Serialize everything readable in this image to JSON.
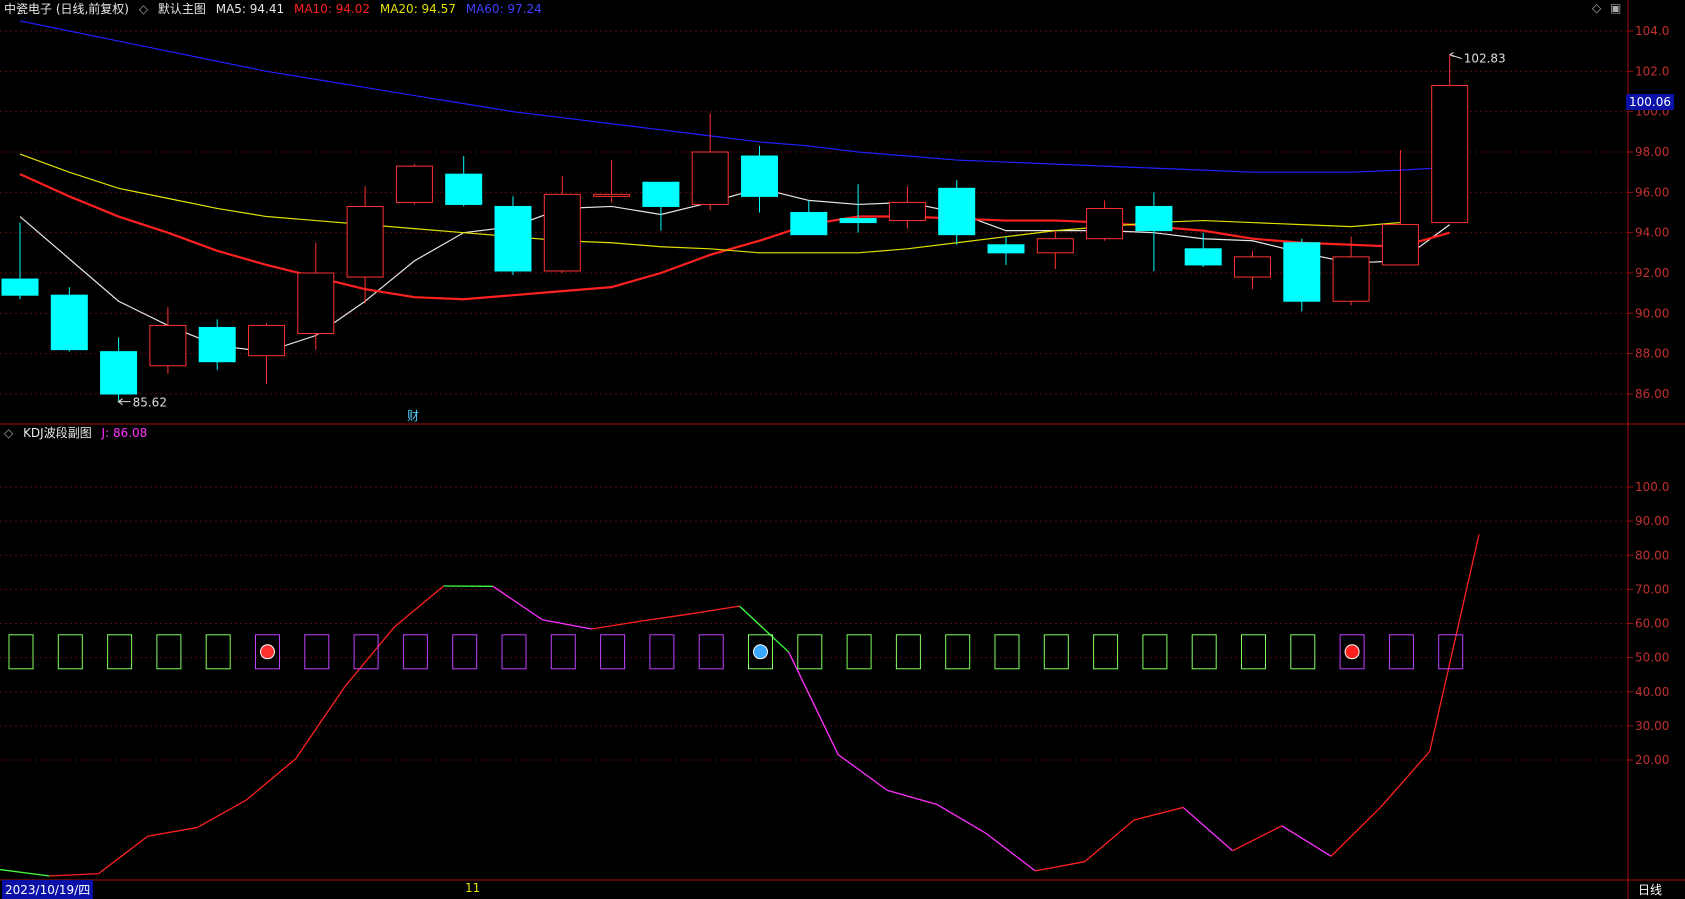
{
  "header": {
    "stock": "中瓷电子 (日线,前复权)",
    "panel_label": "默认主图",
    "ma5": {
      "label": "MA5: 94.41",
      "color": "#e6e6e6"
    },
    "ma10": {
      "label": "MA10: 94.02",
      "color": "#ff2020"
    },
    "ma20": {
      "label": "MA20: 94.57",
      "color": "#e0e000"
    },
    "ma60": {
      "label": "MA60: 97.24",
      "color": "#2020ff"
    }
  },
  "sub_header": {
    "name": "KDJ波段副图",
    "j_label": "J: 86.08"
  },
  "annotations": {
    "high": "102.83",
    "low": "85.62",
    "fin_marker": "财",
    "current_price": "100.06",
    "date": "2023/10/19/四",
    "month_marker": "11",
    "period": "日线"
  },
  "chart_data": [
    {
      "type": "candlestick",
      "ylim": [
        84.7,
        105.2
      ],
      "yticks": [
        "104.0",
        "102.0",
        "100.0",
        "98.00",
        "96.00",
        "94.00",
        "92.00",
        "90.00",
        "88.00",
        "86.00"
      ],
      "candles": [
        {
          "o": 91.7,
          "h": 94.5,
          "l": 90.7,
          "c": 90.9
        },
        {
          "o": 90.9,
          "h": 91.3,
          "l": 88.1,
          "c": 88.2
        },
        {
          "o": 88.1,
          "h": 88.8,
          "l": 85.6,
          "c": 86.0
        },
        {
          "o": 87.4,
          "h": 90.3,
          "l": 87.0,
          "c": 89.4
        },
        {
          "o": 89.3,
          "h": 89.7,
          "l": 87.2,
          "c": 87.6
        },
        {
          "o": 87.9,
          "h": 89.5,
          "l": 86.5,
          "c": 89.4
        },
        {
          "o": 89.0,
          "h": 93.5,
          "l": 88.2,
          "c": 92.0
        },
        {
          "o": 91.8,
          "h": 96.3,
          "l": 90.5,
          "c": 95.3
        },
        {
          "o": 95.5,
          "h": 97.4,
          "l": 95.4,
          "c": 97.3
        },
        {
          "o": 96.9,
          "h": 97.8,
          "l": 95.3,
          "c": 95.4
        },
        {
          "o": 95.3,
          "h": 95.8,
          "l": 91.9,
          "c": 92.1
        },
        {
          "o": 92.1,
          "h": 96.8,
          "l": 92.0,
          "c": 95.9
        },
        {
          "o": 95.8,
          "h": 97.6,
          "l": 95.5,
          "c": 95.9
        },
        {
          "o": 96.5,
          "h": 96.5,
          "l": 94.1,
          "c": 95.3
        },
        {
          "o": 95.4,
          "h": 99.9,
          "l": 95.1,
          "c": 98.0
        },
        {
          "o": 97.8,
          "h": 98.3,
          "l": 95.0,
          "c": 95.8
        },
        {
          "o": 95.0,
          "h": 95.6,
          "l": 93.9,
          "c": 93.9
        },
        {
          "o": 94.7,
          "h": 96.4,
          "l": 94.0,
          "c": 94.5
        },
        {
          "o": 94.6,
          "h": 96.3,
          "l": 94.2,
          "c": 95.5
        },
        {
          "o": 96.2,
          "h": 96.6,
          "l": 93.4,
          "c": 93.9
        },
        {
          "o": 93.4,
          "h": 93.8,
          "l": 92.4,
          "c": 93.0
        },
        {
          "o": 93.0,
          "h": 94.1,
          "l": 92.2,
          "c": 93.7
        },
        {
          "o": 93.7,
          "h": 95.6,
          "l": 93.6,
          "c": 95.2
        },
        {
          "o": 95.3,
          "h": 96.0,
          "l": 92.1,
          "c": 94.1
        },
        {
          "o": 93.2,
          "h": 94.0,
          "l": 92.3,
          "c": 92.4
        },
        {
          "o": 91.8,
          "h": 93.1,
          "l": 91.2,
          "c": 92.8
        },
        {
          "o": 93.5,
          "h": 93.7,
          "l": 90.1,
          "c": 90.6
        },
        {
          "o": 90.6,
          "h": 93.8,
          "l": 90.4,
          "c": 92.8
        },
        {
          "o": 92.4,
          "h": 98.1,
          "l": 92.4,
          "c": 94.4
        },
        {
          "o": 94.5,
          "h": 102.83,
          "l": 94.5,
          "c": 101.3
        }
      ],
      "ma_lines": [
        {
          "name": "MA5",
          "color": "#e6e6e6",
          "values": [
            94.8,
            92.7,
            90.6,
            89.4,
            88.4,
            88.1,
            88.9,
            90.6,
            92.6,
            94.0,
            94.3,
            95.2,
            95.3,
            94.9,
            95.5,
            96.2,
            95.6,
            95.4,
            95.5,
            95.0,
            94.1,
            94.1,
            94.1,
            94.0,
            93.7,
            93.6,
            93.0,
            92.5,
            92.6,
            94.4
          ]
        },
        {
          "name": "MA10",
          "color": "#ff2020",
          "values": [
            96.9,
            95.8,
            94.8,
            94.0,
            93.1,
            92.4,
            91.8,
            91.2,
            90.8,
            90.7,
            90.9,
            91.1,
            91.3,
            92.0,
            92.9,
            93.6,
            94.4,
            94.8,
            94.8,
            94.7,
            94.6,
            94.6,
            94.5,
            94.3,
            94.1,
            93.7,
            93.5,
            93.4,
            93.3,
            94.0
          ]
        },
        {
          "name": "MA20",
          "color": "#e0e000",
          "values": [
            97.9,
            97.0,
            96.2,
            95.7,
            95.2,
            94.8,
            94.6,
            94.4,
            94.2,
            94.0,
            93.8,
            93.6,
            93.5,
            93.3,
            93.2,
            93.0,
            93.0,
            93.0,
            93.2,
            93.5,
            93.8,
            94.1,
            94.3,
            94.5,
            94.6,
            94.5,
            94.4,
            94.3,
            94.5
          ]
        },
        {
          "name": "MA60",
          "color": "#2020ff",
          "values": [
            104.5,
            104.0,
            103.5,
            103.0,
            102.5,
            102.0,
            101.6,
            101.2,
            100.8,
            100.4,
            100.0,
            99.7,
            99.4,
            99.1,
            98.8,
            98.5,
            98.3,
            98.0,
            97.8,
            97.6,
            97.5,
            97.4,
            97.3,
            97.2,
            97.1,
            97.0,
            97.0,
            97.0,
            97.1,
            97.24
          ]
        }
      ]
    },
    {
      "type": "line",
      "ylim": [
        -14,
        125
      ],
      "yticks": [
        "100.0",
        "90.00",
        "80.00",
        "70.00",
        "60.00",
        "50.00",
        "40.00",
        "30.00",
        "20.00"
      ],
      "series": [
        {
          "name": "J",
          "values": [
            -12.1,
            -14.0,
            -13.3,
            -2.3,
            0.2,
            8.3,
            20.4,
            41.6,
            59.0,
            71.0,
            70.9,
            61.1,
            58.4,
            60.7,
            62.8,
            65.1,
            51.6,
            21.6,
            11.1,
            7.0,
            -1.5,
            -12.5,
            -9.8,
            2.4,
            6.1,
            -6.6,
            0.7,
            -8.2,
            6.1,
            22.5,
            86.08
          ]
        }
      ],
      "level_line": 52
    }
  ]
}
